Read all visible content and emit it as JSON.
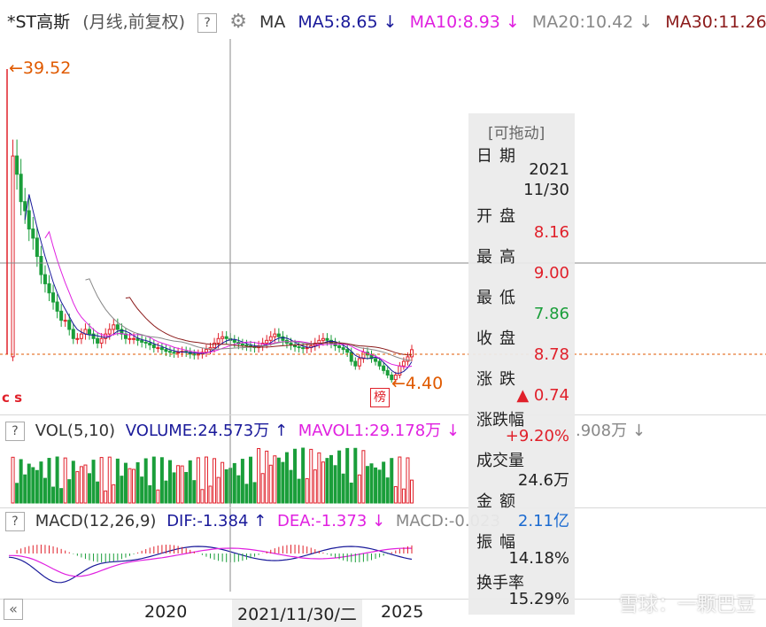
{
  "header": {
    "stock": "*ST高斯",
    "mode": "(月线,前复权)",
    "help": "?",
    "ma_label": "MA",
    "ma5": "MA5:8.65",
    "ma10": "MA10:8.93",
    "ma20": "MA20:10.42",
    "ma30": "MA30:11.26",
    "down_arrow": "↓",
    "up_arrow": "↑"
  },
  "annotations": {
    "high": "39.52",
    "low": "4.40",
    "high_arrow": "←",
    "low_arrow": "←",
    "marks_left": "c s",
    "mark_box": "榜",
    "mark_c": "c"
  },
  "volume_header": {
    "help": "?",
    "name": "VOL(5,10)",
    "volume": "VOLUME:24.573万",
    "mavol1": "MAVOL1:29.178万",
    "mavol2_tail": ".908万"
  },
  "macd_header": {
    "help": "?",
    "name": "MACD(12,26,9)",
    "dif": "DIF:-1.384",
    "dea": "DEA:-1.373",
    "macd": "MACD:-0.023"
  },
  "info_panel": {
    "title": "[可拖动]",
    "rows": [
      {
        "label": "日期",
        "value": "2021\n11/30"
      },
      {
        "label": "开盘",
        "value": "8.16"
      },
      {
        "label": "最高",
        "value": "9.00"
      },
      {
        "label": "最低",
        "value": "7.86"
      },
      {
        "label": "收盘",
        "value": "8.78"
      },
      {
        "label": "涨跌",
        "value": "▲ 0.74"
      },
      {
        "label": "涨跌幅",
        "value": "+9.20%"
      },
      {
        "label": "成交量",
        "value": "24.6万"
      },
      {
        "label": "金额",
        "value": "2.11亿"
      },
      {
        "label": "振幅",
        "value": "14.18%"
      },
      {
        "label": "换手率",
        "value": "15.29%"
      }
    ]
  },
  "footer": {
    "collapse": "«",
    "x_labels": [
      "2020",
      "2021/11/30/二",
      "2025"
    ]
  },
  "watermark": "雪球：一颗巴豆",
  "colors": {
    "up": "#e0202a",
    "down": "#1a9e3a",
    "ma5": "#1a1a9a",
    "ma10": "#e020e0",
    "ma20": "#888888",
    "ma30": "#8b1a1a",
    "accent_orange": "#e05a00",
    "macd_dif": "#1a1a9a",
    "macd_dea": "#e020e0"
  },
  "chart_data": {
    "type": "candlestick",
    "period": "monthly",
    "price_high": 39.52,
    "price_low": 4.4,
    "last_close": 8.78,
    "selected": {
      "date": "2021/11/30",
      "open": 8.16,
      "high": 9.0,
      "low": 7.86,
      "close": 8.78
    },
    "close_series": [
      8,
      30,
      28,
      25,
      24,
      22,
      21,
      19,
      17,
      16,
      15,
      14,
      13,
      12,
      12,
      11,
      10,
      10,
      10.5,
      11,
      10.5,
      10,
      9.5,
      10,
      10.5,
      11,
      11.5,
      11,
      10.5,
      10,
      10,
      10,
      9.8,
      9.6,
      9.5,
      9.3,
      9,
      9,
      8.8,
      8.6,
      8.5,
      8.4,
      8.5,
      8.6,
      8.5,
      8.3,
      8.2,
      8.3,
      8.5,
      8.8,
      9,
      9.5,
      10,
      10.2,
      10,
      9.8,
      9.6,
      9.4,
      9.3,
      9.2,
      9.1,
      9,
      9.2,
      9.5,
      9.8,
      10.2,
      10.5,
      10.2,
      9.8,
      9.5,
      9.3,
      9.1,
      9,
      8.9,
      9,
      9.2,
      9.5,
      9.8,
      10,
      9.8,
      9.5,
      9.2,
      9,
      8.8,
      8.5,
      7.5,
      7,
      7.8,
      8.5,
      8.2,
      7.8,
      7.5,
      7,
      6.5,
      6,
      5.5,
      6,
      7,
      7.5,
      8,
      8.78
    ],
    "ma5": 8.65,
    "ma10": 8.93,
    "ma20": 10.42,
    "ma30": 11.26,
    "volume": 24.573,
    "mavol1": 29.178,
    "dif": -1.384,
    "dea": -1.373,
    "macd": -0.023
  }
}
